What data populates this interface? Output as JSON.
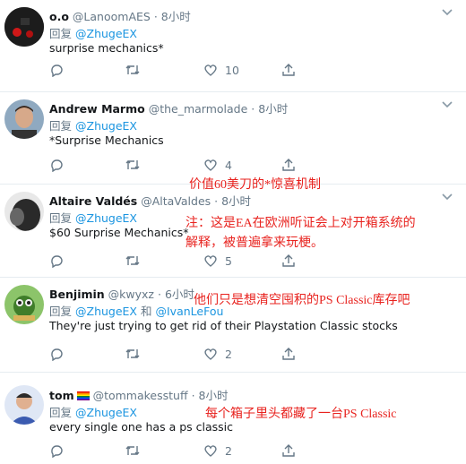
{
  "tweets": [
    {
      "name": "o.o",
      "handle": "@LanoomAES",
      "separator": "·",
      "time": "8小时",
      "reply_prefix": "回复",
      "mention": "@ZhugeEX",
      "body": "surprise mechanics*",
      "like_count": "10",
      "avatar_color": "#222222"
    },
    {
      "name": "Andrew Marmo",
      "handle": "@the_marmolade",
      "separator": "·",
      "time": "8小时",
      "reply_prefix": "回复",
      "mention": "@ZhugeEX",
      "body": "*Surprise Mechanics",
      "like_count": "4",
      "avatar_color": "#c99a7a"
    },
    {
      "name": "Altaire Valdés",
      "handle": "@AltaValdes",
      "separator": "·",
      "time": "8小时",
      "reply_prefix": "回复",
      "mention": "@ZhugeEX",
      "body": "$60 Surprise Mechanics*",
      "like_count": "5",
      "avatar_color": "#3a3a3a"
    },
    {
      "name": "Benjimin",
      "handle": "@kwyxz",
      "separator": "·",
      "time": "6小时",
      "reply_prefix": "回复",
      "mention": "@ZhugeEX",
      "mention_joiner": "和",
      "mention2": "@IvanLeFou",
      "body": "They're just trying to get rid of their Playstation Classic stocks",
      "like_count": "2",
      "avatar_color": "#5a8f3a"
    },
    {
      "name": "tom",
      "handle": "@tommakesstuff",
      "separator": "·",
      "time": "8小时",
      "reply_prefix": "回复",
      "mention": "@ZhugeEX",
      "body": "every single one has a ps classic",
      "like_count": "2",
      "avatar_color": "#3b5bb0"
    }
  ],
  "annotations": {
    "line1": "价值60美刀的*惊喜机制",
    "line2a": "注：这是EA在欧洲听证会上对开箱系统的",
    "line2b": "解释，被普遍拿来玩梗。",
    "line3": "他们只是想清空囤积的PS Classic库存吧",
    "line4": "每个箱子里头都藏了一台PS Classic"
  },
  "colors": {
    "annotation": "#e8231f",
    "mention": "#1b95e0",
    "muted": "#657786",
    "divider": "#e6ecf0"
  },
  "icons": [
    "reply-icon",
    "retweet-icon",
    "like-icon",
    "share-icon",
    "chevron-down-icon"
  ]
}
